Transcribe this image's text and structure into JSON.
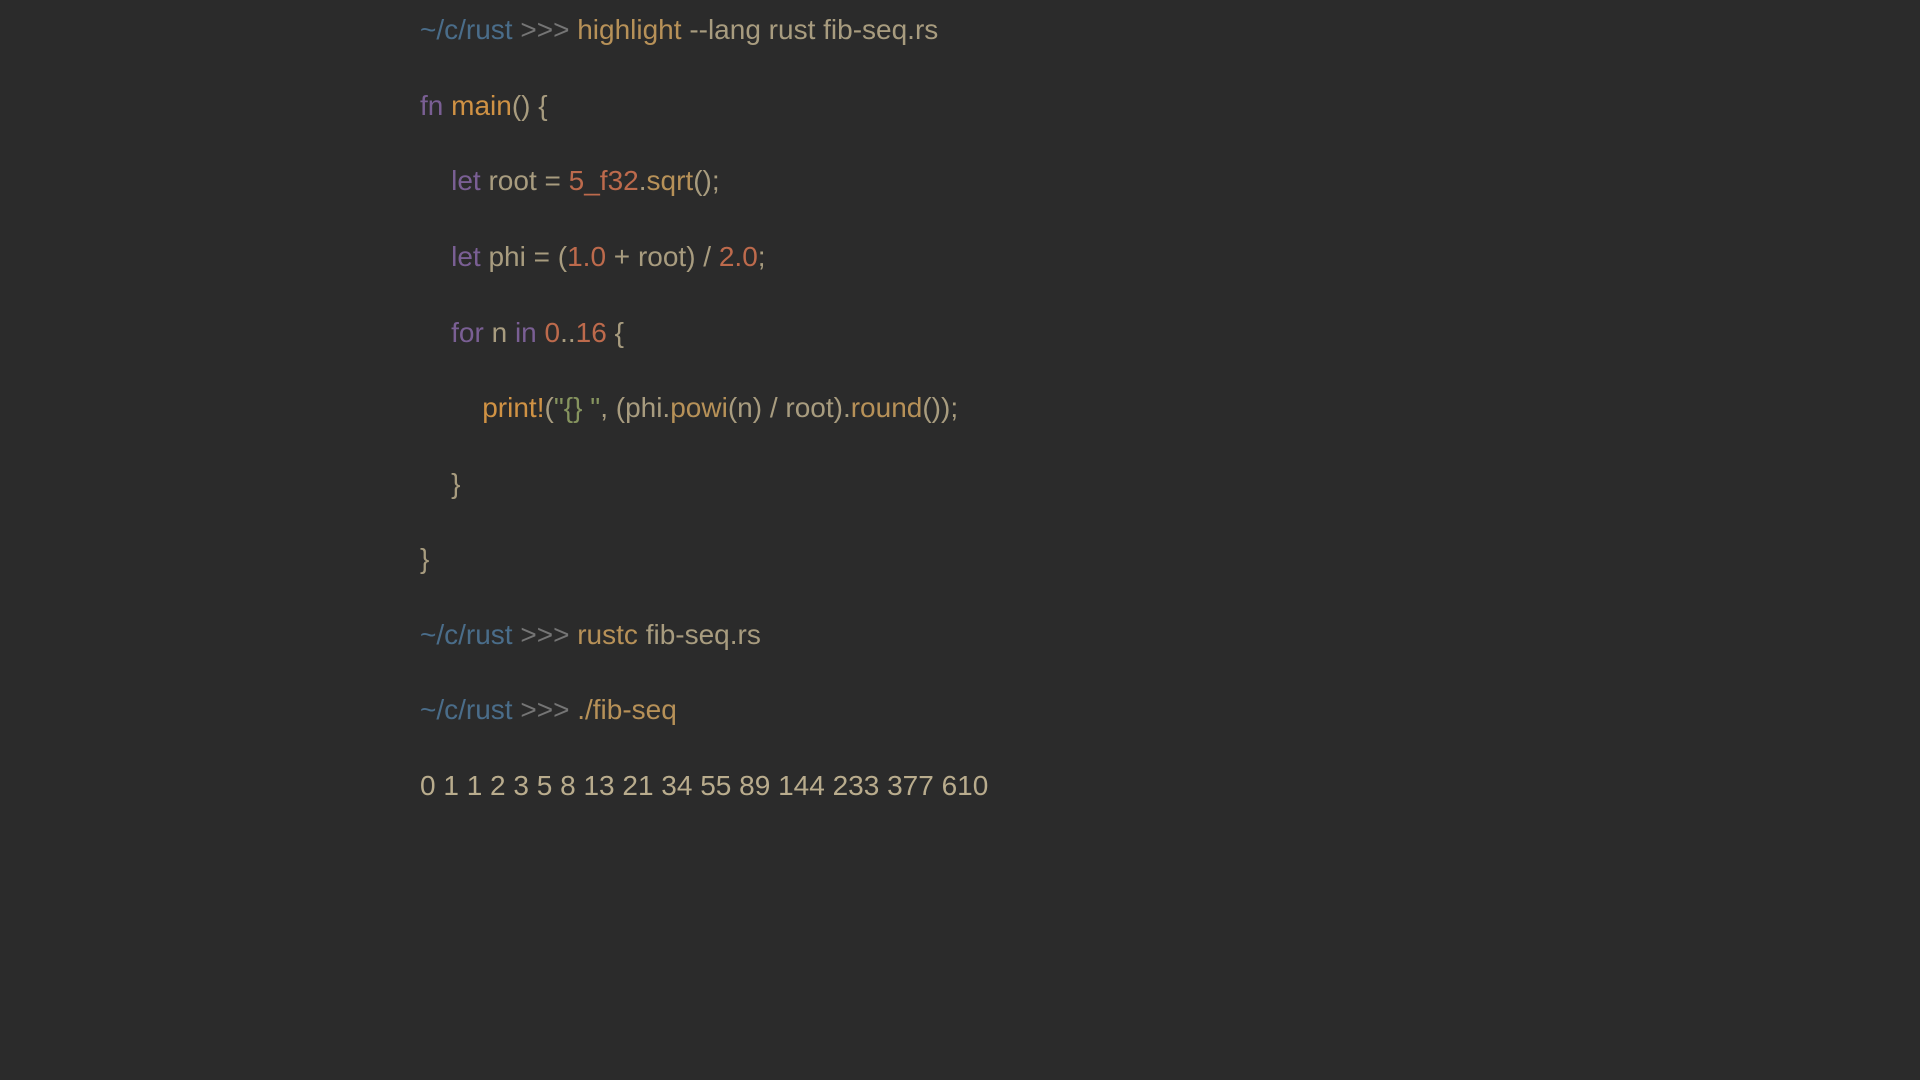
{
  "prompt": {
    "path": "~/c/rust",
    "symbol": " >>> "
  },
  "line1": {
    "cmd": "highlight ",
    "args": "--lang rust fib-seq.rs"
  },
  "code": {
    "line2": {
      "fn": "fn ",
      "main": "main",
      "rest": "() {"
    },
    "line3": {
      "indent": "    ",
      "let": "let ",
      "name": "root = ",
      "num": "5_f32",
      "dot": ".",
      "method": "sqrt",
      "end": "();"
    },
    "line4": {
      "indent": "    ",
      "let": "let ",
      "name": "phi = (",
      "num1": "1.0",
      "plus": " + root) / ",
      "num2": "2.0",
      "end": ";"
    },
    "line5": {
      "indent": "    ",
      "for": "for ",
      "n": "n ",
      "in": "in ",
      "range1": "0",
      "dots": "..",
      "range2": "16",
      "end": " {"
    },
    "line6": {
      "indent": "        ",
      "print": "print!",
      "open": "(",
      "str": "\"{} \"",
      "mid1": ", (phi.",
      "powi": "powi",
      "mid2": "(n) / root).",
      "round": "round",
      "end": "());"
    },
    "line7": {
      "indent": "    ",
      "brace": "}"
    },
    "line8": {
      "brace": "}"
    }
  },
  "line9": {
    "cmd": "rustc ",
    "args": "fib-seq.rs"
  },
  "line10": {
    "cmd": "./fib-seq"
  },
  "output": "0 1 1 2 3 5 8 13 21 34 55 89 144 233 377 610 "
}
